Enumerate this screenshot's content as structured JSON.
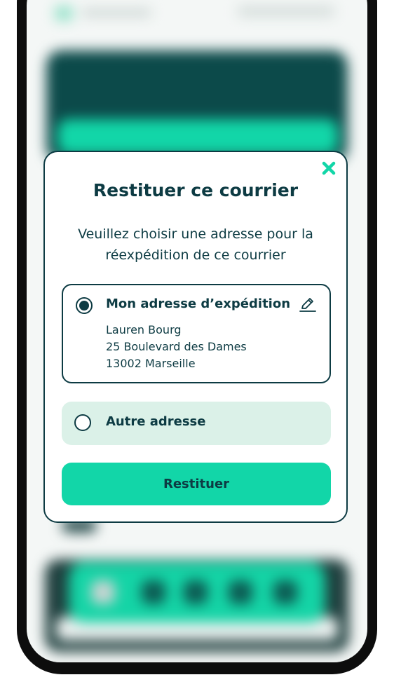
{
  "modal": {
    "title": "Restituer ce courrier",
    "subtitle_line1": "Veuillez choisir une adresse pour la",
    "subtitle_line2": "réexpédition de ce courrier",
    "close_icon": "close-icon",
    "options": [
      {
        "label": "Mon adresse d’expédition",
        "selected": true,
        "icon": "pencil-edit-icon",
        "address": [
          "Lauren Bourg",
          "25 Boulevard des Dames",
          "13002 Marseille"
        ]
      },
      {
        "label": "Autre adresse",
        "selected": false
      }
    ],
    "submit_label": "Restituer"
  },
  "colors": {
    "primary_dark": "#0d3b43",
    "accent": "#12d6a8",
    "option_bg": "#dbf1e8"
  }
}
